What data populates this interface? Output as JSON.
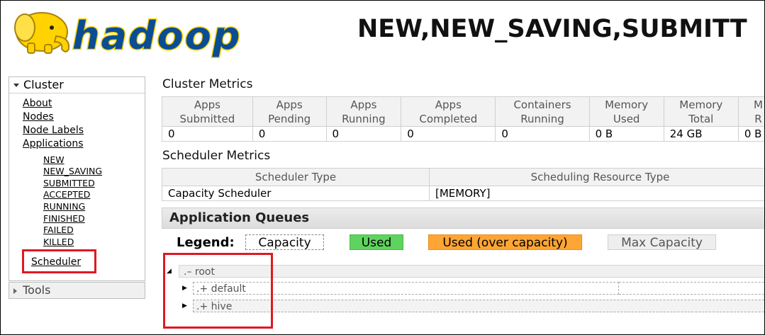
{
  "header": {
    "logo_text": "hadoop",
    "title": "NEW,NEW_SAVING,SUBMITT"
  },
  "sidebar": {
    "cluster_label": "Cluster",
    "cluster_items": [
      "About",
      "Nodes",
      "Node Labels",
      "Applications"
    ],
    "application_states": [
      "NEW",
      "NEW_SAVING",
      "SUBMITTED",
      "ACCEPTED",
      "RUNNING",
      "FINISHED",
      "FAILED",
      "KILLED"
    ],
    "scheduler_label": "Scheduler",
    "tools_label": "Tools"
  },
  "cluster_metrics": {
    "title": "Cluster Metrics",
    "headers": [
      [
        "Apps",
        "Submitted"
      ],
      [
        "Apps",
        "Pending"
      ],
      [
        "Apps",
        "Running"
      ],
      [
        "Apps",
        "Completed"
      ],
      [
        "Containers",
        "Running"
      ],
      [
        "Memory",
        "Used"
      ],
      [
        "Memory",
        "Total"
      ],
      [
        "M",
        "R"
      ]
    ],
    "values": [
      "0",
      "0",
      "0",
      "0",
      "0",
      "0 B",
      "24 GB",
      "0 B"
    ]
  },
  "scheduler_metrics": {
    "title": "Scheduler Metrics",
    "headers": [
      "Scheduler Type",
      "Scheduling Resource Type"
    ],
    "values": [
      "Capacity Scheduler",
      "[MEMORY]"
    ]
  },
  "queues": {
    "title": "Application Queues",
    "legend_label": "Legend:",
    "legend": {
      "capacity": "Capacity",
      "used": "Used",
      "over": "Used (over capacity)",
      "max": "Max Capacity"
    },
    "items": [
      {
        "prefix": ".–",
        "name": "root"
      },
      {
        "prefix": ".+",
        "name": "default"
      },
      {
        "prefix": ".+",
        "name": "hive"
      }
    ]
  },
  "colors": {
    "highlight": "#e01822",
    "used": "#5fd35f",
    "over_capacity": "#ffa533",
    "logo_yellow": "#ffd200",
    "logo_blue": "#0a4d95"
  }
}
